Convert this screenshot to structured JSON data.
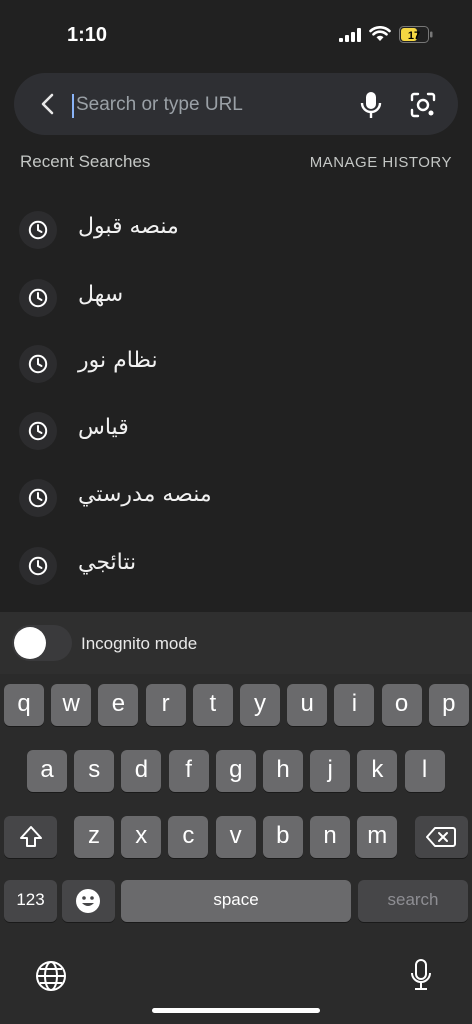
{
  "status_bar": {
    "time": "1:10",
    "battery_level": "17",
    "battery_color": "#f5d742"
  },
  "search": {
    "placeholder": "Search or type URL",
    "value": ""
  },
  "recent": {
    "title": "Recent Searches",
    "manage_label": "MANAGE HISTORY",
    "items": [
      {
        "label": "منصه قبول",
        "icon": "clock-icon"
      },
      {
        "label": "سهل",
        "icon": "clock-icon"
      },
      {
        "label": "نظام نور",
        "icon": "clock-icon"
      },
      {
        "label": "قياس",
        "icon": "clock-icon"
      },
      {
        "label": "منصه مدرستي",
        "icon": "clock-icon"
      },
      {
        "label": "نتائجي",
        "icon": "clock-icon"
      }
    ]
  },
  "incognito": {
    "label": "Incognito mode",
    "enabled": false
  },
  "keyboard": {
    "row1": [
      "q",
      "w",
      "e",
      "r",
      "t",
      "y",
      "u",
      "i",
      "o",
      "p"
    ],
    "row2": [
      "a",
      "s",
      "d",
      "f",
      "g",
      "h",
      "j",
      "k",
      "l"
    ],
    "row3": [
      "z",
      "x",
      "c",
      "v",
      "b",
      "n",
      "m"
    ],
    "numbers_label": "123",
    "space_label": "space",
    "search_label": "search"
  }
}
